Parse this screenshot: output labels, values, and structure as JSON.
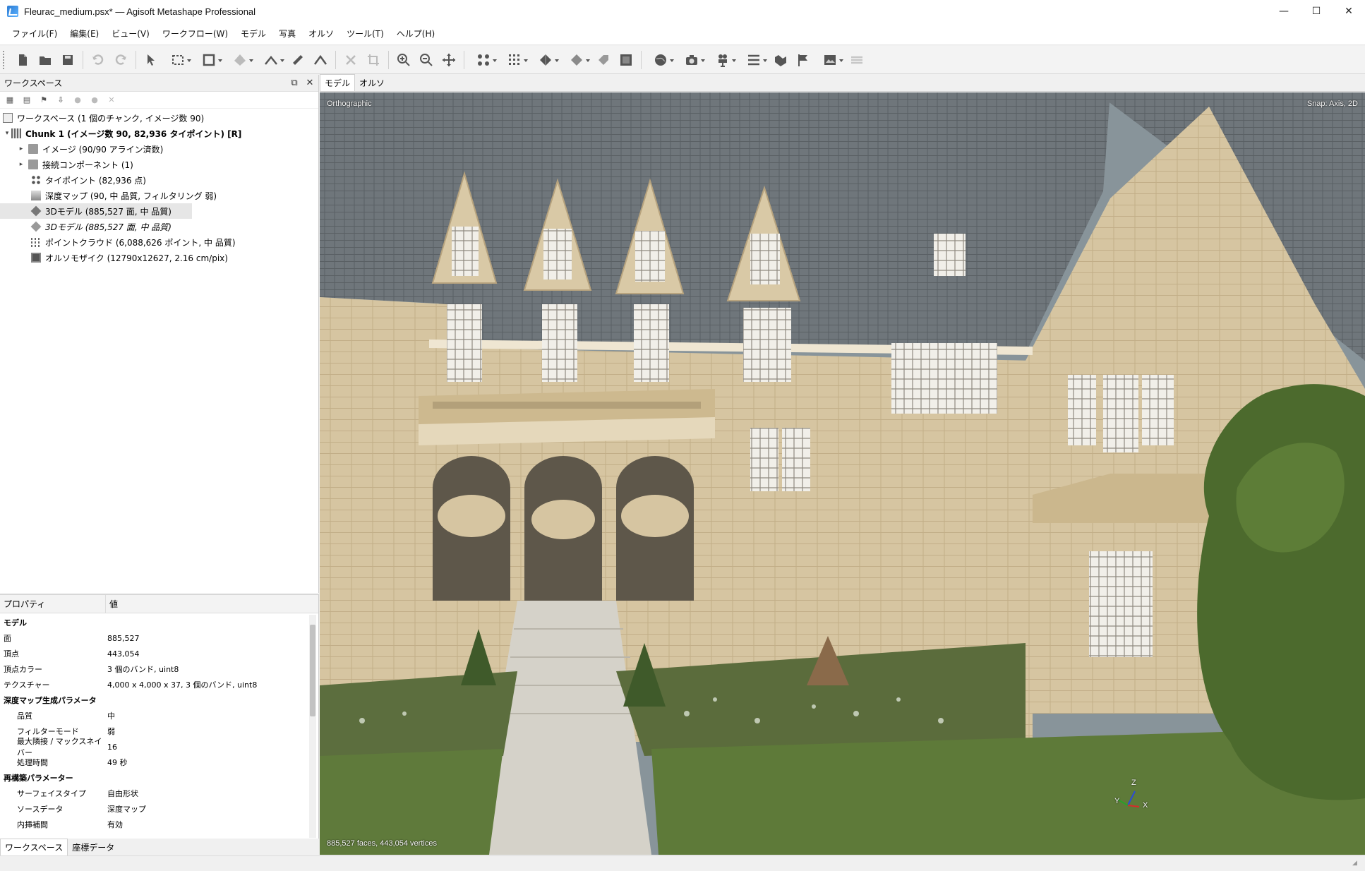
{
  "window": {
    "title": "Fleurac_medium.psx* — Agisoft Metashape Professional",
    "minimize": "—",
    "maximize": "☐",
    "close": "✕"
  },
  "menu": [
    "ファイル(F)",
    "編集(E)",
    "ビュー(V)",
    "ワークフロー(W)",
    "モデル",
    "写真",
    "オルソ",
    "ツール(T)",
    "ヘルプ(H)"
  ],
  "workspace": {
    "title": "ワークスペース",
    "tree": [
      {
        "label": "ワークスペース (1 個のチャンク, イメージ数 90)",
        "level": 0,
        "expander": "",
        "icon": "workspace-icon"
      },
      {
        "label": "Chunk 1 (イメージ数 90, 82,936 タイポイント) [R]",
        "level": 0,
        "expander": "▾",
        "icon": "chunk-icon",
        "bold": true
      },
      {
        "label": "イメージ (90/90 アライン済数)",
        "level": 1,
        "expander": "▸",
        "icon": "folder-icon"
      },
      {
        "label": "接続コンポーネント (1)",
        "level": 1,
        "expander": "▸",
        "icon": "folder-icon"
      },
      {
        "label": "タイポイント (82,936 点)",
        "level": 2,
        "expander": "",
        "icon": "tie-points-icon"
      },
      {
        "label": "深度マップ (90, 中 品質, フィルタリング 弱)",
        "level": 2,
        "expander": "",
        "icon": "depth-map-icon"
      },
      {
        "label": "3Dモデル (885,527 面, 中 品質)",
        "level": 2,
        "expander": "",
        "icon": "model-icon",
        "selected": true
      },
      {
        "label": "3Dモデル (885,527 面, 中 品質)",
        "level": 2,
        "expander": "",
        "icon": "model-icon",
        "italic": true
      },
      {
        "label": "ポイントクラウド (6,088,626 ポイント, 中 品質)",
        "level": 2,
        "expander": "",
        "icon": "point-cloud-icon"
      },
      {
        "label": "オルソモザイク (12790x12627, 2.16 cm/pix)",
        "level": 2,
        "expander": "",
        "icon": "orthomosaic-icon"
      }
    ]
  },
  "properties": {
    "col_property": "プロパティ",
    "col_value": "値",
    "rows": [
      {
        "key": "モデル",
        "value": "",
        "group": true
      },
      {
        "key": "面",
        "value": "885,527"
      },
      {
        "key": "頂点",
        "value": "443,054"
      },
      {
        "key": "頂点カラー",
        "value": "3 個のバンド, uint8"
      },
      {
        "key": "テクスチャー",
        "value": "4,000 x 4,000 x 37, 3 個のバンド, uint8"
      },
      {
        "key": "深度マップ生成パラメータ",
        "value": "",
        "group": true
      },
      {
        "key": "品質",
        "value": "中",
        "indent": true
      },
      {
        "key": "フィルターモード",
        "value": "弱",
        "indent": true
      },
      {
        "key": "最大隣接 / マックスネイバー",
        "value": "16",
        "indent": true
      },
      {
        "key": "処理時間",
        "value": "49 秒",
        "indent": true
      },
      {
        "key": "再構築パラメーター",
        "value": "",
        "group": true
      },
      {
        "key": "サーフェイスタイプ",
        "value": "自由形状",
        "indent": true
      },
      {
        "key": "ソースデータ",
        "value": "深度マップ",
        "indent": true
      },
      {
        "key": "内挿補間",
        "value": "有効",
        "indent": true
      }
    ]
  },
  "bottom_tabs": [
    "ワークスペース",
    "座標データ"
  ],
  "view_tabs": [
    "モデル",
    "オルソ"
  ],
  "viewport": {
    "projection": "Orthographic",
    "snap": "Snap: Axis, 2D",
    "stats": "885,527 faces, 443,054 vertices",
    "axis_x": "X",
    "axis_y": "Y",
    "axis_z": "Z"
  },
  "colors": {
    "roof": "#6e7478",
    "stone": "#d8c7a3",
    "grass": "#5a7a3a",
    "tree": "#4b6a2c"
  }
}
